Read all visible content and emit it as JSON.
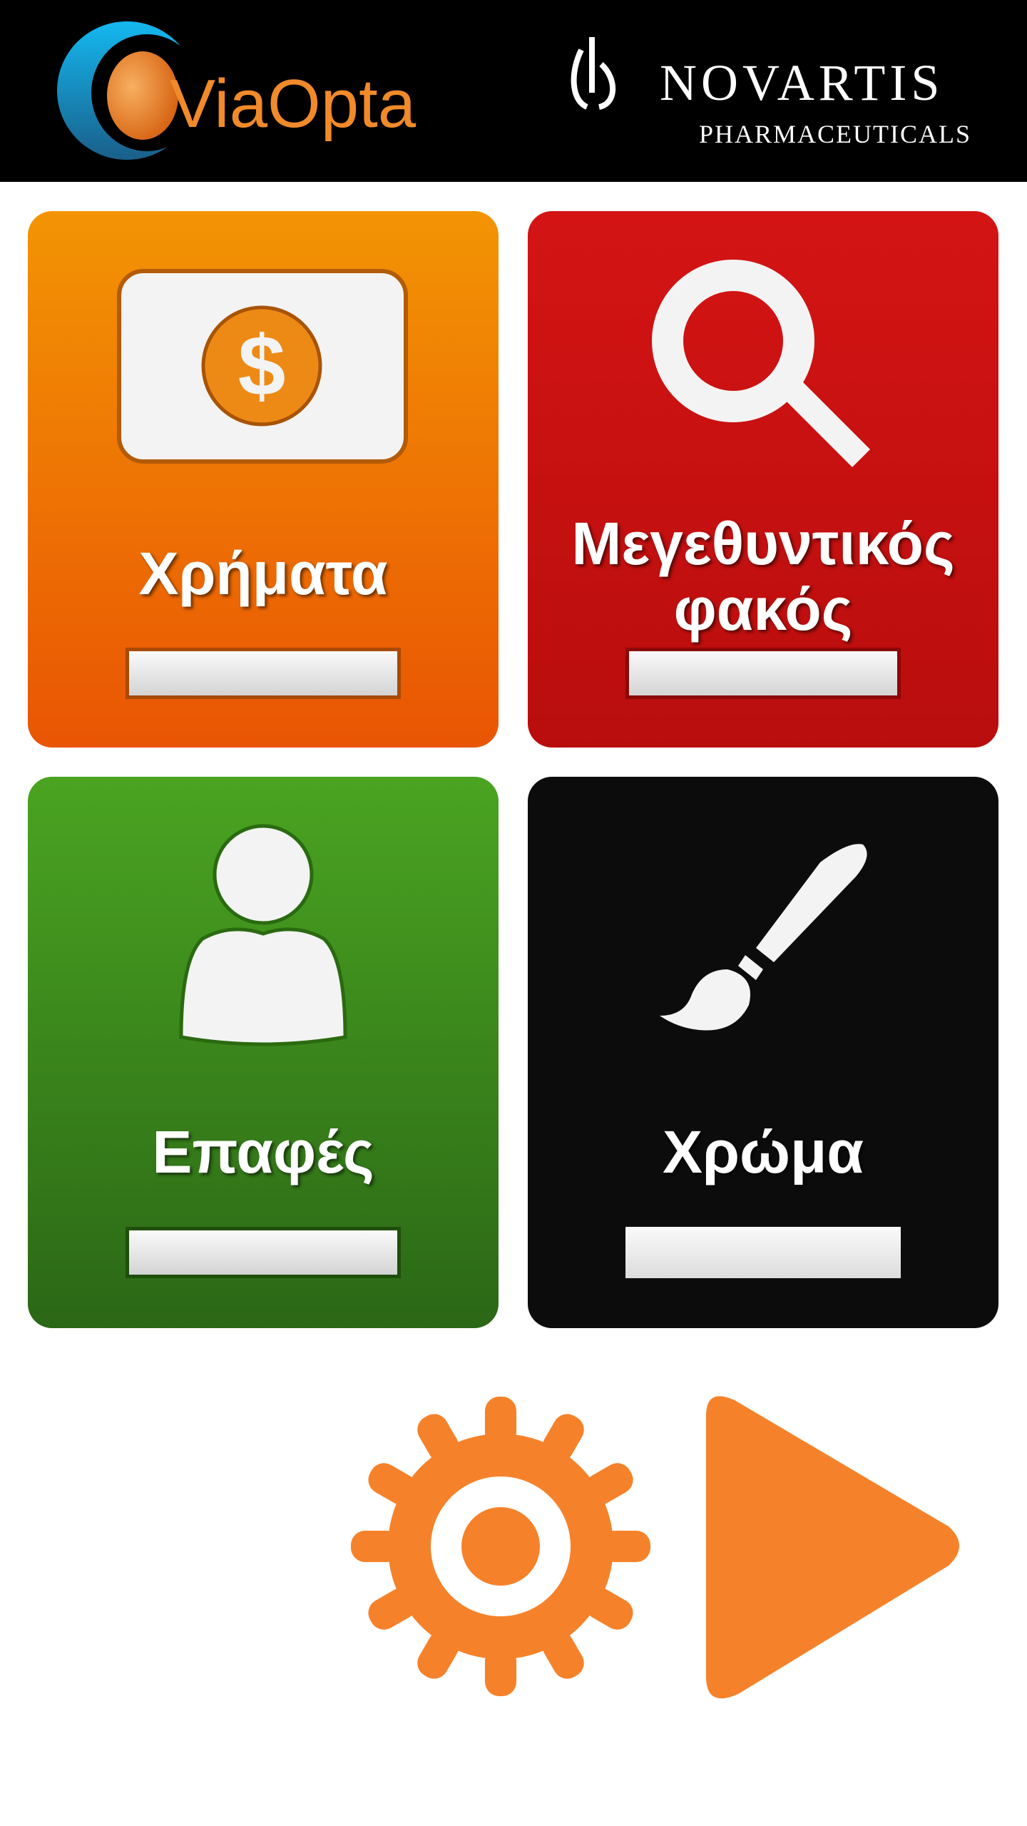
{
  "header": {
    "left_logo": "ViaOpta",
    "right_logo_name": "NOVARTIS",
    "right_logo_sub": "PHARMACEUTICALS"
  },
  "tiles": [
    {
      "label": "Χρήματα",
      "icon": "money-icon",
      "color": "#f08a04"
    },
    {
      "label_line1": "Μεγεθυντικός",
      "label_line2": "φακός",
      "icon": "magnifier-icon",
      "color": "#cc1212"
    },
    {
      "label": "Επαφές",
      "icon": "contact-person-icon",
      "color": "#3d8a1d"
    },
    {
      "label": "Χρώμα",
      "icon": "paintbrush-icon",
      "color": "#0c0c0d"
    }
  ],
  "bottom": {
    "settings_icon": "gear-icon",
    "play_icon": "play-icon",
    "accent": "#f5822a"
  }
}
